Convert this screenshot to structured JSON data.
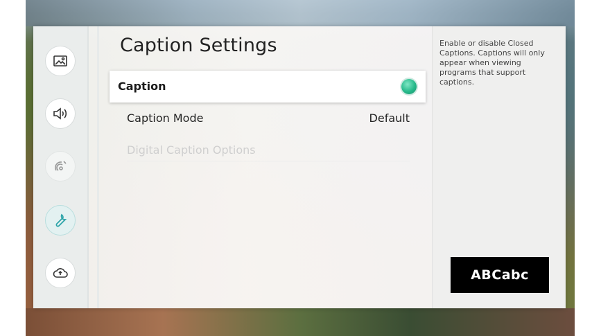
{
  "page": {
    "title": "Caption Settings"
  },
  "nav": {
    "items": [
      {
        "icon": "picture-icon"
      },
      {
        "icon": "sound-icon"
      },
      {
        "icon": "broadcasting-icon"
      },
      {
        "icon": "general-wrench-icon"
      },
      {
        "icon": "support-cloud-icon"
      }
    ],
    "active_index": 3
  },
  "settings": {
    "caption": {
      "label": "Caption",
      "state": "on",
      "indicator_color": "#26b98a"
    },
    "caption_mode": {
      "label": "Caption Mode",
      "value": "Default"
    },
    "digital_caption_options": {
      "label": "Digital Caption Options",
      "enabled": false
    }
  },
  "help": {
    "description": "Enable or disable Closed Captions. Captions will only appear when viewing programs that support captions.",
    "preview_text": "ABCabc"
  }
}
